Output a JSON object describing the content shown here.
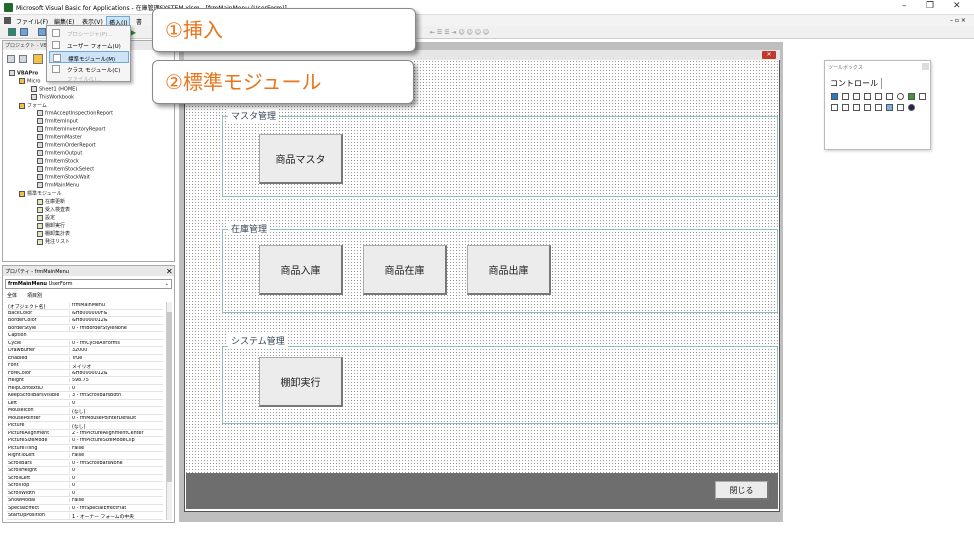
{
  "window": {
    "title": "Microsoft Visual Basic for Applications - 在庫管理SYSTEM.xlsm - [frmMainMenu (UserForm)]"
  },
  "menubar": {
    "items": [
      "ファイル(F)",
      "編集(E)",
      "表示(V)",
      "挿入(I)",
      "書"
    ]
  },
  "insert_menu": {
    "items": [
      {
        "label": "プロシージャ(P)...",
        "disabled": true
      },
      {
        "label": "ユーザー フォーム(U)",
        "disabled": false
      },
      {
        "label": "標準モジュール(M)",
        "disabled": false
      },
      {
        "label": "クラス モジュール(C)",
        "disabled": false
      },
      {
        "label": "ファイル(L)...",
        "disabled": true
      }
    ]
  },
  "callouts": {
    "one": "①挿入",
    "two": "②標準モジュール"
  },
  "project": {
    "header": "プロジェクト - VBAPro",
    "root": "VBAPro",
    "microsoft": "Micro",
    "sheet": "Sheet1 (HOME)",
    "workbook": "ThisWorkbook",
    "forms_folder": "フォーム",
    "forms": [
      "frmAcceptInspectionReport",
      "frmItemInput",
      "frmItemInventoryReport",
      "frmItemMaster",
      "frmItemOrderReport",
      "frmItemOutput",
      "frmItemStock",
      "frmItemStockSelect",
      "frmItemStockWait",
      "frmMainMenu"
    ],
    "modules_folder": "標準モジュール",
    "modules": [
      "在庫更新",
      "受入検査表",
      "設定",
      "棚卸実行",
      "棚卸集計表",
      "発注リスト"
    ]
  },
  "properties": {
    "header": "プロパティ - frmMainMenu",
    "object_name": "frmMainMenu",
    "object_type": "UserForm",
    "tab_all": "全体",
    "tab_cat": "項目別",
    "rows": [
      [
        "(オブジェクト名)",
        "frmMainMenu"
      ],
      [
        "BackColor",
        "&H8000000F&"
      ],
      [
        "BorderColor",
        "&H80000012&"
      ],
      [
        "BorderStyle",
        "0 - fmBorderStyleNone"
      ],
      [
        "Caption",
        ""
      ],
      [
        "Cycle",
        "0 - fmCycleAllForms"
      ],
      [
        "DrawBuffer",
        "32000"
      ],
      [
        "Enabled",
        "True"
      ],
      [
        "Font",
        "メイリオ"
      ],
      [
        "ForeColor",
        "&H80000012&"
      ],
      [
        "Height",
        "598.75"
      ],
      [
        "HelpContextID",
        "0"
      ],
      [
        "KeepScrollBarsVisible",
        "3 - fmScrollBarsBoth"
      ],
      [
        "Left",
        "0"
      ],
      [
        "MouseIcon",
        "(なし)"
      ],
      [
        "MousePointer",
        "0 - fmMousePointerDefault"
      ],
      [
        "Picture",
        "(なし)"
      ],
      [
        "PictureAlignment",
        "2 - fmPictureAlignmentCenter"
      ],
      [
        "PictureSizeMode",
        "0 - fmPictureSizeModeClip"
      ],
      [
        "PictureTiling",
        "False"
      ],
      [
        "RightToLeft",
        "False"
      ],
      [
        "ScrollBars",
        "0 - fmScrollBarsNone"
      ],
      [
        "ScrollHeight",
        "0"
      ],
      [
        "ScrollLeft",
        "0"
      ],
      [
        "ScrollTop",
        "0"
      ],
      [
        "ScrollWidth",
        "0"
      ],
      [
        "ShowModal",
        "False"
      ],
      [
        "SpecialEffect",
        "0 - fmSpecialEffectFlat"
      ],
      [
        "StartUpPosition",
        "1 - オーナー フォームの中央"
      ]
    ]
  },
  "userform": {
    "frame_master": {
      "label": "マスタ管理",
      "buttons": [
        "商品マスタ"
      ]
    },
    "frame_stock": {
      "label": "在庫管理",
      "buttons": [
        "商品入庫",
        "商品在庫",
        "商品出庫"
      ]
    },
    "frame_system": {
      "label": "システム管理",
      "buttons": [
        "棚卸実行"
      ]
    },
    "close_button": "閉じる"
  },
  "toolbox": {
    "title": "ツールボックス",
    "tab": "コントロール"
  },
  "colors": {
    "callout_text": "#e8741b",
    "menu_highlight": "#cde4f7",
    "footer": "#6e6e6e"
  }
}
